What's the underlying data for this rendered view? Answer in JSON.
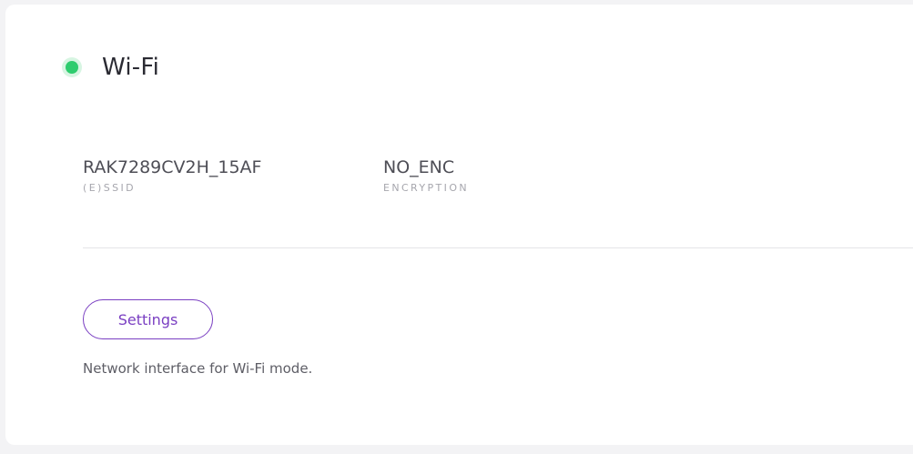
{
  "card": {
    "title": "Wi-Fi",
    "status": "active",
    "status_color": "#2ecc6e",
    "ssid": {
      "value": "RAK7289CV2H_15AF",
      "label": "(E)SSID"
    },
    "encryption": {
      "value": "NO_ENC",
      "label": "ENCRYPTION"
    },
    "settings_label": "Settings",
    "accent_color": "#7a3fc2",
    "description": "Network interface for Wi-Fi mode."
  }
}
